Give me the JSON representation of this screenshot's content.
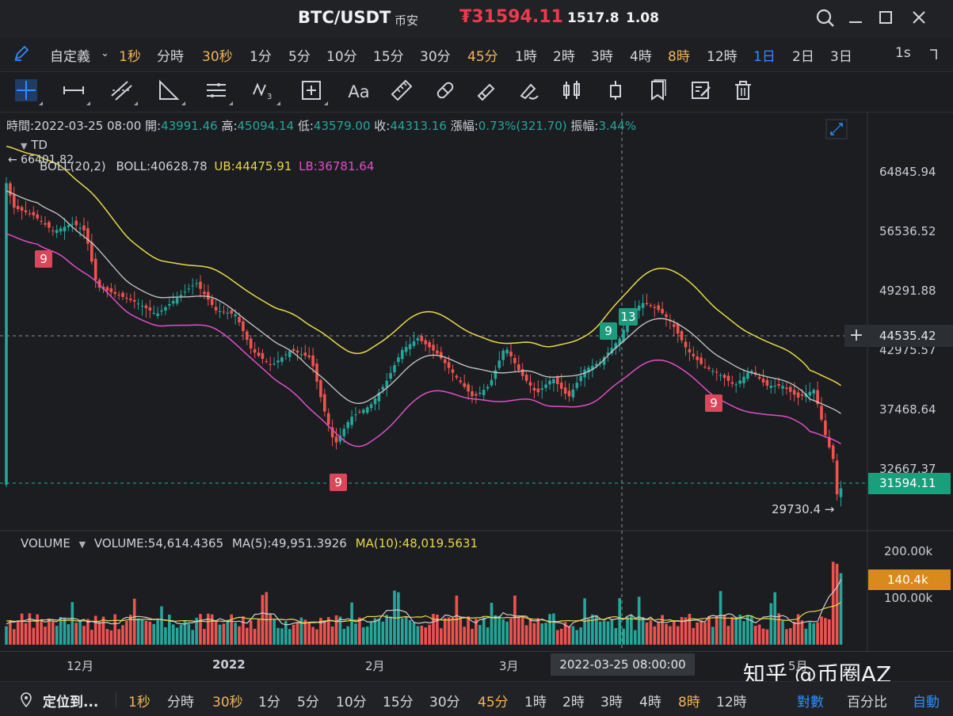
{
  "title": {
    "pair": "BTC/USDT",
    "exchange": "币安",
    "price": "₮31594.11",
    "change": "1517.8",
    "change_pct": "1.08"
  },
  "intervals_top": [
    "自定義",
    "1秒",
    "分時",
    "30秒",
    "1分",
    "5分",
    "10分",
    "15分",
    "30分",
    "45分",
    "1時",
    "2時",
    "3時",
    "4時",
    "8時",
    "12時",
    "1日",
    "2日",
    "3日",
    "1s"
  ],
  "intervals_bottom": [
    "1秒",
    "分時",
    "30秒",
    "1分",
    "5分",
    "10分",
    "15分",
    "30分",
    "45分",
    "1時",
    "2時",
    "3時",
    "4時",
    "8時",
    "12時"
  ],
  "bottom": {
    "locate": "定位到...",
    "log": "對數",
    "percent": "百分比",
    "auto": "自動"
  },
  "ohlc": {
    "time_label": "時間:",
    "time": "2022-03-25 08:00",
    "open_label": "開:",
    "open": "43991.46",
    "high_label": "高:",
    "high": "45094.14",
    "low_label": "低:",
    "low": "43579.00",
    "close_label": "收:",
    "close": "44313.16",
    "change_label": "漲幅:",
    "change": "0.73%(321.70)",
    "amp_label": "振幅:",
    "amp": "3.44%"
  },
  "indicators": {
    "td": "TD",
    "boll_name": "BOLL(20,2)",
    "boll": "BOLL:40628.78",
    "ub": "UB:44475.91",
    "lb": "LB:36781.64",
    "vol_name": "VOLUME",
    "volume": "VOLUME:54,614.4365",
    "ma5": "MA(5):49,951.3926",
    "ma10": "MA(10):48,019.5631"
  },
  "price_axis": [
    "64845.94",
    "56536.52",
    "49291.88",
    "42975.57",
    "37468.64",
    "32667.37"
  ],
  "crosshair_price": "44535.42",
  "last_price": "31594.11",
  "max_label": "← 66401.82",
  "min_label": "29730.4 →",
  "volume_axis": [
    "200.00k",
    "100.00k"
  ],
  "volume_last": "140.4k",
  "time_axis": [
    "12月",
    "2022",
    "2月",
    "3月",
    "5月"
  ],
  "crosshair_time": "2022-03-25 08:00:00",
  "td_marks": [
    "9",
    "9",
    "9",
    "13",
    "9"
  ],
  "watermark": "知乎 @币圈AZ",
  "colors": {
    "up": "#26a69a",
    "down": "#ef5350",
    "boll_up": "#e8d84a",
    "boll_low": "#e04fc6",
    "boll_mid": "#c8c8c8",
    "accent": "#2f8dff",
    "orange": "#f1b45a"
  }
}
